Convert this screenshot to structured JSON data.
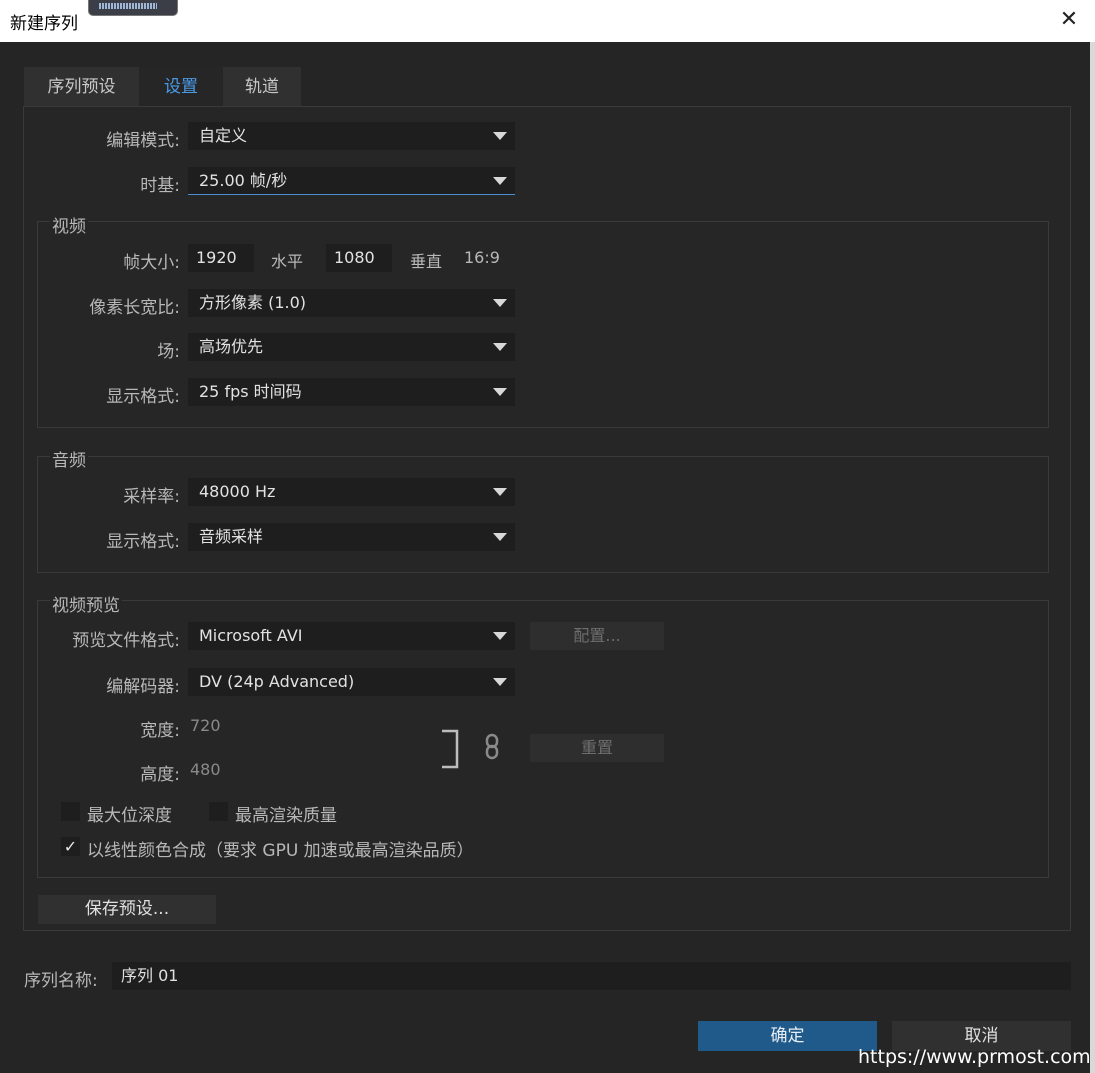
{
  "window": {
    "title": "新建序列",
    "close_icon": "✕"
  },
  "tabs": [
    {
      "label": "序列预设",
      "active": false
    },
    {
      "label": "设置",
      "active": true
    },
    {
      "label": "轨道",
      "active": false
    }
  ],
  "settings": {
    "edit_mode_label": "编辑模式:",
    "edit_mode_value": "自定义",
    "timebase_label": "时基:",
    "timebase_value": "25.00 帧/秒"
  },
  "video": {
    "title": "视频",
    "frame_size_label": "帧大小:",
    "frame_width": "1920",
    "horizontal_label": "水平",
    "frame_height": "1080",
    "vertical_label": "垂直",
    "aspect": "16:9",
    "pixel_aspect_label": "像素长宽比:",
    "pixel_aspect_value": "方形像素 (1.0)",
    "fields_label": "场:",
    "fields_value": "高场优先",
    "display_format_label": "显示格式:",
    "display_format_value": "25 fps 时间码"
  },
  "audio": {
    "title": "音频",
    "sample_rate_label": "采样率:",
    "sample_rate_value": "48000 Hz",
    "display_format_label": "显示格式:",
    "display_format_value": "音频采样"
  },
  "preview": {
    "title": "视频预览",
    "file_format_label": "预览文件格式:",
    "file_format_value": "Microsoft AVI",
    "configure_label": "配置...",
    "codec_label": "编解码器:",
    "codec_value": "DV (24p Advanced)",
    "width_label": "宽度:",
    "width_value": "720",
    "height_label": "高度:",
    "height_value": "480",
    "reset_label": "重置",
    "max_bit_depth_label": "最大位深度",
    "max_render_quality_label": "最高渲染质量",
    "linear_color_label": "以线性颜色合成（要求 GPU 加速或最高渲染品质）",
    "linear_color_checked": true,
    "check_glyph": "✓"
  },
  "save_preset_label": "保存预设...",
  "sequence_name_label": "序列名称:",
  "sequence_name_value": "序列 01",
  "ok_label": "确定",
  "cancel_label": "取消",
  "watermark": "https://www.prmost.com"
}
